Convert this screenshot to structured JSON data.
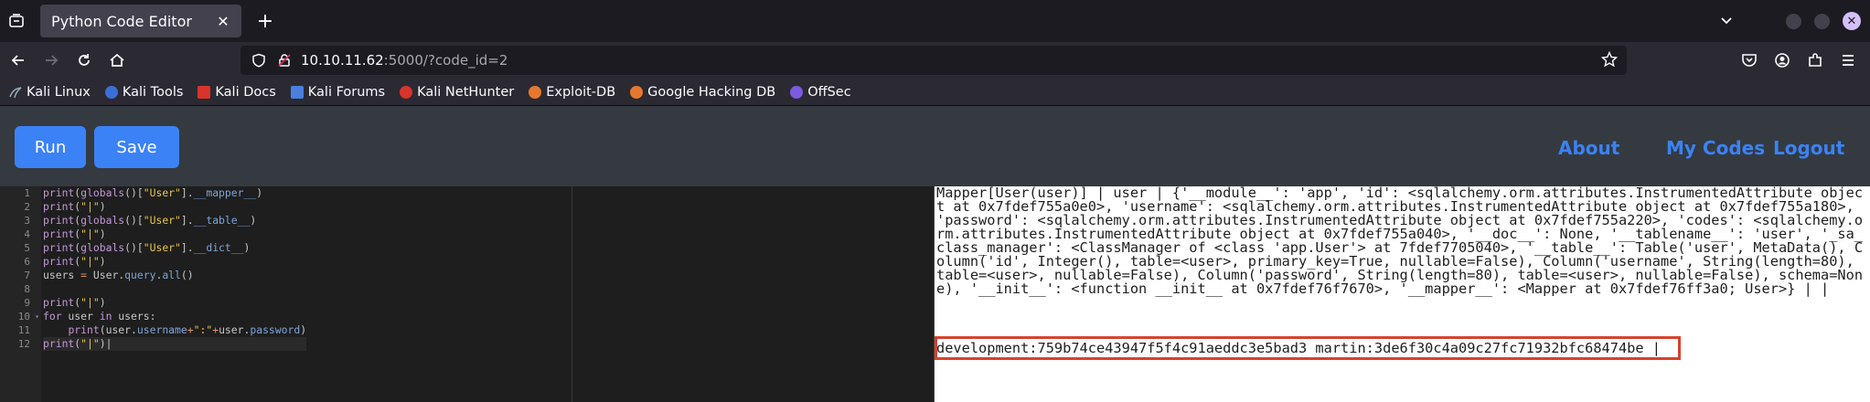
{
  "browser": {
    "tab_title": "Python Code Editor",
    "url_host": "10.10.11.62",
    "url_rest": ":5000/?code_id=2",
    "bookmarks": [
      "Kali Linux",
      "Kali Tools",
      "Kali Docs",
      "Kali Forums",
      "Kali NetHunter",
      "Exploit-DB",
      "Google Hacking DB",
      "OffSec"
    ]
  },
  "header": {
    "run_label": "Run",
    "save_label": "Save",
    "nav": [
      "About",
      "My Codes",
      "Logout"
    ]
  },
  "editor": {
    "line_numbers": [
      "1",
      "2",
      "3",
      "4",
      "5",
      "6",
      "7",
      "8",
      "9",
      "10",
      "11",
      "12"
    ]
  },
  "output": {
    "text": "Mapper[User(user)] | user | {'__module__': 'app', 'id': <sqlalchemy.orm.attributes.InstrumentedAttribute object at 0x7fdef755a0e0>, 'username': <sqlalchemy.orm.attributes.InstrumentedAttribute object at 0x7fdef755a180>, 'password': <sqlalchemy.orm.attributes.InstrumentedAttribute object at 0x7fdef755a220>, 'codes': <sqlalchemy.orm.attributes.InstrumentedAttribute object at 0x7fdef755a040>, '__doc__': None, '__tablename__': 'user', '_sa_class_manager': <ClassManager of <class 'app.User'> at 7fdef7705040>, '__table__': Table('user', MetaData(), Column('id', Integer(), table=<user>, primary_key=True, nullable=False), Column('username', String(length=80), table=<user>, nullable=False), Column('password', String(length=80), table=<user>, nullable=False), schema=None), '__init__': <function __init__ at 0x7fdef76f7670>, '__mapper__': <Mapper at 0x7fdef76ff3a0; User>} | |",
    "credentials": "development:759b74ce43947f5f4c91aeddc3e5bad3 martin:3de6f30c4a09c27fc71932bfc68474be |"
  },
  "colors": {
    "accent": "#3b82f6",
    "highlight": "#d9412b"
  }
}
